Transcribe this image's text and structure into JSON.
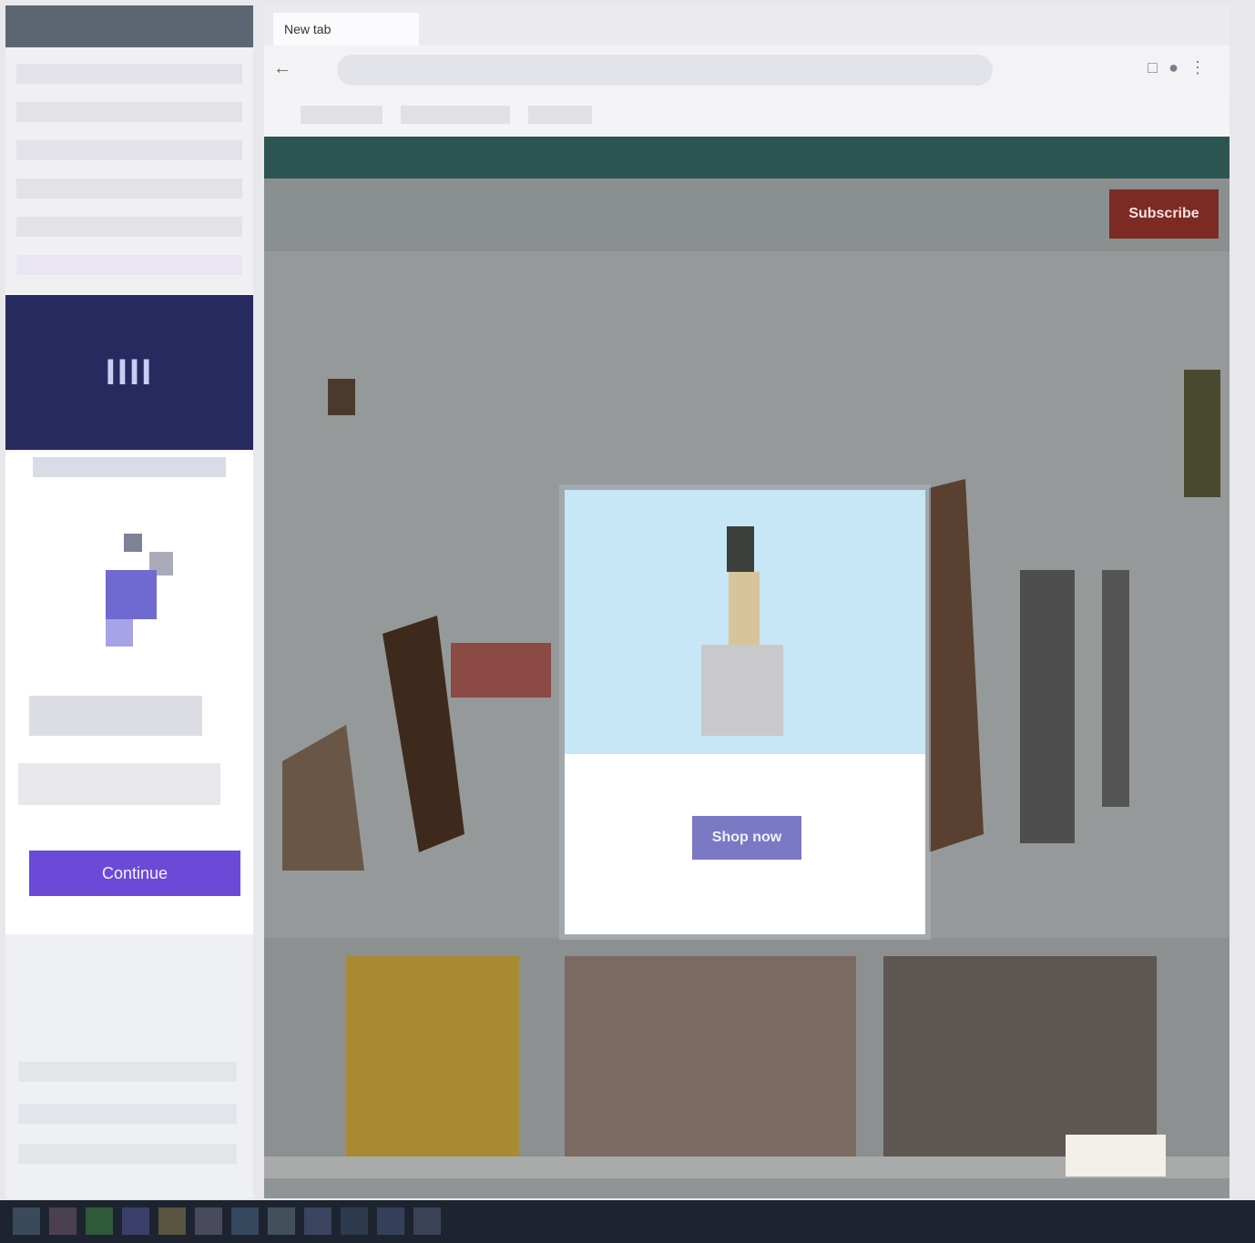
{
  "left_panel": {
    "logo_text": "IIII",
    "continue_label": "Continue"
  },
  "browser": {
    "active_tab": "New tab",
    "address": "",
    "site": {
      "nav_items": [
        "",
        "",
        "",
        "",
        "",
        "",
        ""
      ],
      "subscribe_label": "Subscribe",
      "headline": ""
    },
    "modal": {
      "headline": "",
      "subline": "",
      "cta_label": "Shop now"
    }
  },
  "colors": {
    "left_header": "#262a5e",
    "accent_button": "#6b4ad8",
    "site_banner": "#2c5552",
    "subscribe": "#7c2a24",
    "modal_cta": "#7b78c4"
  },
  "icons": [
    "back-icon",
    "forward-icon",
    "reload-icon",
    "extension-icon",
    "profile-icon",
    "menu-icon"
  ]
}
